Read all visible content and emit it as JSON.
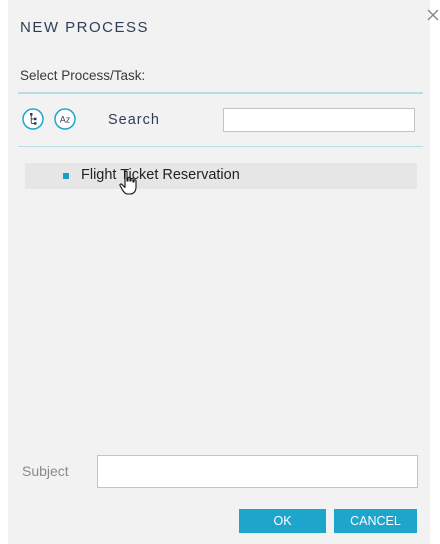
{
  "dialog": {
    "title": "NEW PROCESS",
    "subtitle": "Select Process/Task:",
    "close_icon": "close-icon"
  },
  "toolbar": {
    "tree_view_icon": "tree-view-icon",
    "sort_az_icon": "sort-az-icon",
    "search_label": "Search",
    "search_value": "",
    "sort_glyph": "Az"
  },
  "process_list": {
    "items": [
      {
        "label": "Flight Ticket Reservation"
      }
    ]
  },
  "subject": {
    "label": "Subject",
    "value": ""
  },
  "buttons": {
    "ok": "OK",
    "cancel": "CANCEL"
  },
  "colors": {
    "accent": "#1ea5cc",
    "title": "#2f3e55",
    "divider": "#b9dbe6",
    "dialog_bg": "#f2f2f2"
  }
}
